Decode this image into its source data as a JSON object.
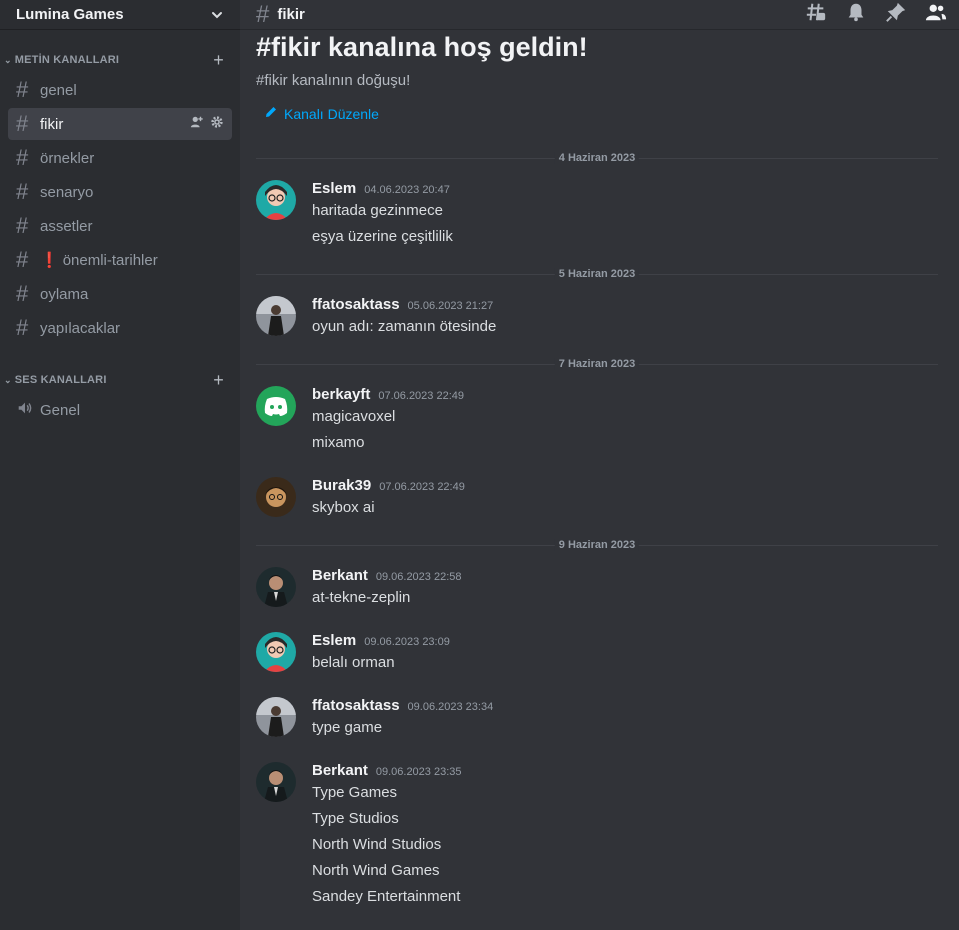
{
  "server": {
    "name": "Lumina Games"
  },
  "categories": {
    "text": "METİN KANALLARI",
    "voice": "SES KANALLARI"
  },
  "text_channels": [
    {
      "name": "genel"
    },
    {
      "name": "fikir"
    },
    {
      "name": "örnekler"
    },
    {
      "name": "senaryo"
    },
    {
      "name": "assetler"
    },
    {
      "name": "önemli-tarihler",
      "prefix": "❗"
    },
    {
      "name": "oylama"
    },
    {
      "name": "yapılacaklar"
    }
  ],
  "voice_channels": [
    {
      "name": "Genel"
    }
  ],
  "topbar": {
    "channel_name": "fikir"
  },
  "welcome": {
    "title": "#fikir kanalına hoş geldin!",
    "subtitle": "#fikir kanalının doğuşu!",
    "edit_label": "Kanalı Düzenle"
  },
  "dates": [
    "4 Haziran 2023",
    "5 Haziran 2023",
    "7 Haziran 2023",
    "9 Haziran 2023"
  ],
  "messages": [
    {
      "author": "Eslem",
      "time": "04.06.2023 20:47",
      "lines": [
        "haritada gezinmece",
        "eşya üzerine çeşitlilik"
      ]
    },
    {
      "author": "ffatosaktass",
      "time": "05.06.2023 21:27",
      "lines": [
        "oyun adı: zamanın ötesinde"
      ]
    },
    {
      "author": "berkayft",
      "time": "07.06.2023 22:49",
      "lines": [
        "magicavoxel",
        "mixamo"
      ]
    },
    {
      "author": "Burak39",
      "time": "07.06.2023 22:49",
      "lines": [
        "skybox ai"
      ]
    },
    {
      "author": "Berkant",
      "time": "09.06.2023 22:58",
      "lines": [
        "at-tekne-zeplin"
      ]
    },
    {
      "author": "Eslem",
      "time": "09.06.2023 23:09",
      "lines": [
        "belalı orman"
      ]
    },
    {
      "author": "ffatosaktass",
      "time": "09.06.2023 23:34",
      "lines": [
        "type game"
      ]
    },
    {
      "author": "Berkant",
      "time": "09.06.2023 23:35",
      "lines": [
        "Type Games",
        "Type Studios",
        "North Wind Studios",
        "North Wind Games",
        "Sandey Entertainment"
      ]
    }
  ],
  "colors": {
    "sidebar_bg": "#2b2d31",
    "main_bg": "#313338",
    "link": "#00a8fc",
    "discord_green": "#23a55a"
  }
}
